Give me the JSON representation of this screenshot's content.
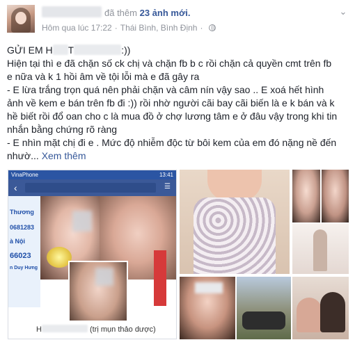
{
  "post": {
    "headline_action": "đã thêm",
    "headline_count": "23 ảnh mới.",
    "timestamp": "Hôm qua lúc 17:22",
    "location": "Thái Bình, Bình Định",
    "icons": {
      "privacy": "globe-icon",
      "menu": "chevron-down-icon"
    }
  },
  "body": {
    "line1_prefix": "GỬI EM H",
    "line1_mid": "T",
    "line1_suffix": ":))",
    "line2": "Hiện tại thì e đã chặn số ck chị và chặn fb b c rồi chặn cả quyền cmt trên fb",
    "line3": "e nữa và k 1 hồi âm về tội lỗi mà e đã gây ra",
    "line4": "- E lừa trắng trọn quá nên phải chặn và câm nín vậy sao .. E xoá hết hình",
    "line5": "ảnh về kem e bán trên fb đi :)) rồi nhờ người cãi bay cãi biến là e k bán và k",
    "line6": "hề biết rồi đổ oan cho c là mua đồ ở chợ lương tâm e ở đâu vậy trong khi tin",
    "line7": "nhắn bằng chứng rõ ràng",
    "line8": "- E nhìn mặt chị đi e . Mức độ nhiễm độc từ bôi kem của em đó nặng nề đến",
    "line9": "nhườ...",
    "see_more": "Xem thêm"
  },
  "phone_screenshot": {
    "carrier": "VinaPhone",
    "clock": "13:41",
    "ad_lines": [
      "Thương",
      "0681283",
      "à Nội",
      "66023",
      "n Duy Hưng"
    ],
    "caption_prefix": "H",
    "caption_suffix": "(trị mụn thảo dược)"
  },
  "colors": {
    "link": "#365899",
    "meta": "#90949c",
    "fb_blue": "#3b5998"
  }
}
